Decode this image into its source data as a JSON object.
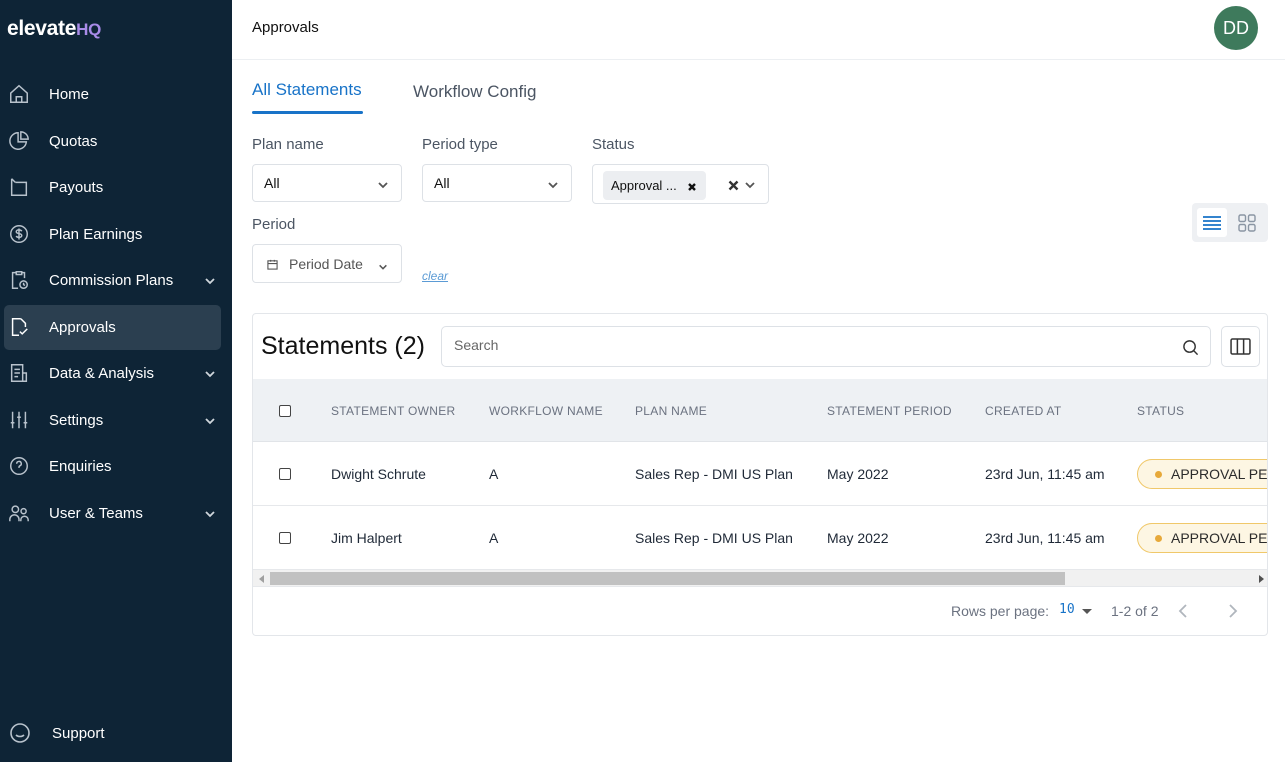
{
  "app": {
    "logo_main": "elevate",
    "logo_hq": "HQ"
  },
  "sidebar": {
    "items": [
      {
        "label": "Home",
        "icon": "home-icon",
        "expandable": false
      },
      {
        "label": "Quotas",
        "icon": "pie-chart-icon",
        "expandable": false
      },
      {
        "label": "Payouts",
        "icon": "wallet-icon",
        "expandable": false
      },
      {
        "label": "Plan Earnings",
        "icon": "dollar-circle-icon",
        "expandable": false
      },
      {
        "label": "Commission Plans",
        "icon": "clipboard-clock-icon",
        "expandable": true
      },
      {
        "label": "Approvals",
        "icon": "approval-document-icon",
        "expandable": false,
        "active": true
      },
      {
        "label": "Data & Analysis",
        "icon": "report-icon",
        "expandable": true
      },
      {
        "label": "Settings",
        "icon": "sliders-icon",
        "expandable": true
      },
      {
        "label": "Enquiries",
        "icon": "question-circle-icon",
        "expandable": false
      },
      {
        "label": "User & Teams",
        "icon": "users-icon",
        "expandable": true
      }
    ],
    "support_label": "Support"
  },
  "header": {
    "title": "Approvals",
    "avatar_initials": "DD",
    "avatar_color": "#3e7a5c"
  },
  "tabs": [
    {
      "label": "All Statements",
      "active": true
    },
    {
      "label": "Workflow Config",
      "active": false
    }
  ],
  "filters": {
    "plan_name": {
      "label": "Plan name",
      "value": "All"
    },
    "period_type": {
      "label": "Period type",
      "value": "All"
    },
    "status": {
      "label": "Status",
      "chip": "Approval ..."
    },
    "period": {
      "label": "Period",
      "placeholder": "Period Date"
    },
    "clear_label": "clear"
  },
  "table": {
    "title": "Statements (2)",
    "search_placeholder": "Search",
    "columns": [
      "STATEMENT OWNER",
      "WORKFLOW NAME",
      "PLAN NAME",
      "STATEMENT PERIOD",
      "CREATED AT",
      "STATUS"
    ],
    "rows": [
      {
        "owner": "Dwight Schrute",
        "workflow": "A",
        "plan": "Sales Rep - DMI US Plan",
        "period": "May 2022",
        "created": "23rd Jun, 11:45 am",
        "status": "APPROVAL PE"
      },
      {
        "owner": "Jim Halpert",
        "workflow": "A",
        "plan": "Sales Rep - DMI US Plan",
        "period": "May 2022",
        "created": "23rd Jun, 11:45 am",
        "status": "APPROVAL PE"
      }
    ],
    "pagination": {
      "rows_per_page_label": "Rows per page:",
      "rows_per_page": "10",
      "range": "1-2 of 2"
    }
  },
  "colors": {
    "accent": "#1873c8",
    "sidebar_bg": "#0e2436",
    "status_pending": "#e7a93a"
  }
}
